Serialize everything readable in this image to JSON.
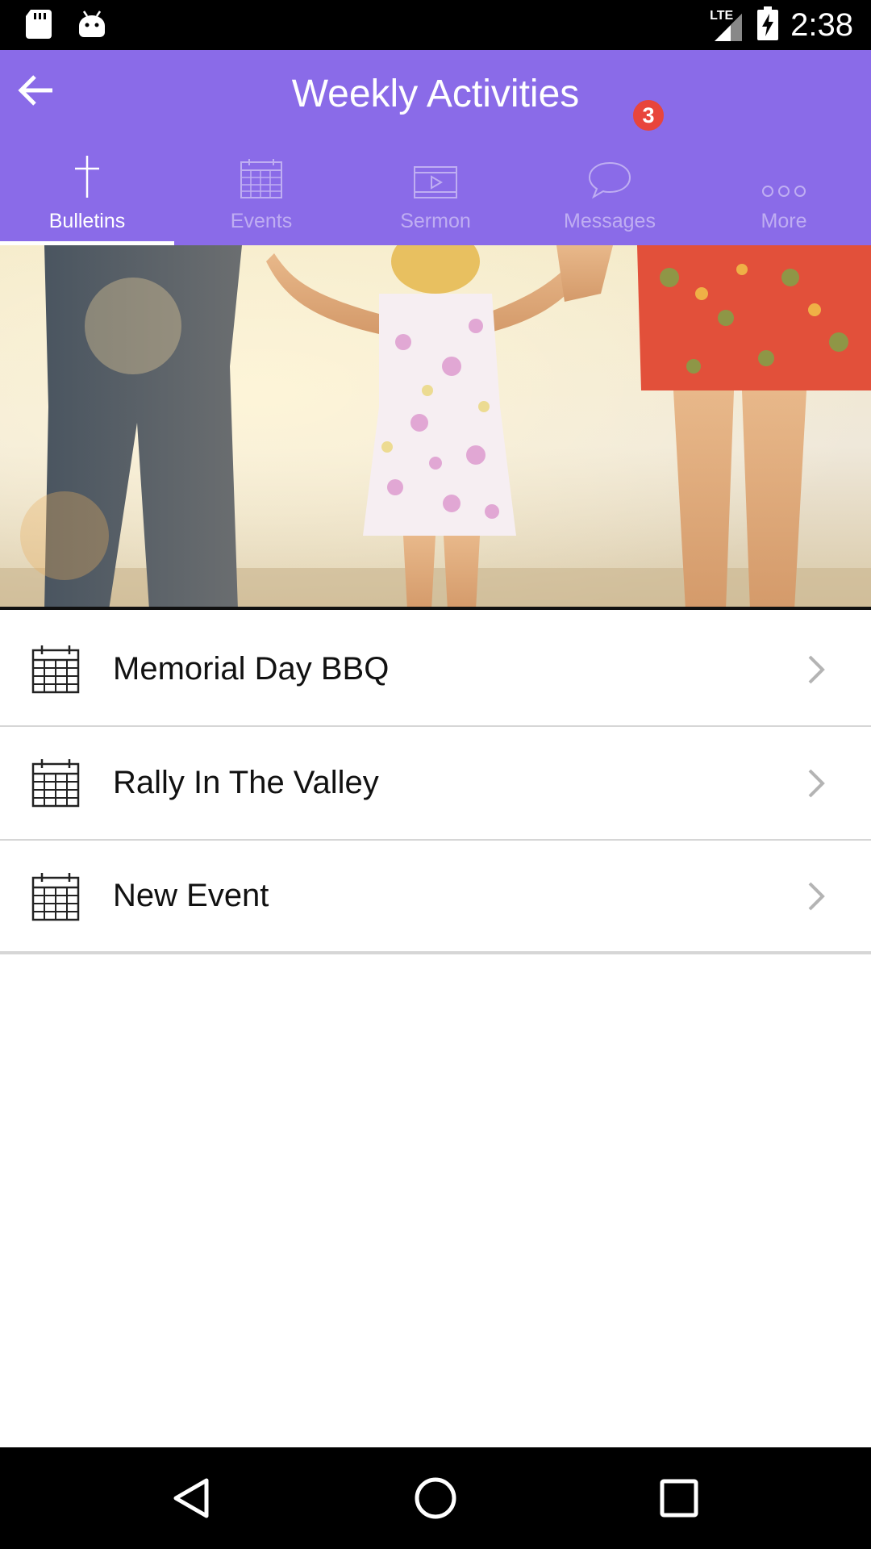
{
  "status_bar": {
    "time": "2:38",
    "network": "LTE",
    "icons": [
      "sd-card-icon",
      "android-icon",
      "signal-icon",
      "battery-charging-icon"
    ]
  },
  "header": {
    "title": "Weekly Activities",
    "back_icon": "arrow-left-icon"
  },
  "tabs": [
    {
      "label": "Bulletins",
      "icon": "cross-icon",
      "active": true
    },
    {
      "label": "Events",
      "icon": "calendar-icon",
      "active": false
    },
    {
      "label": "Sermon",
      "icon": "video-icon",
      "active": false
    },
    {
      "label": "Messages",
      "icon": "chat-bubble-icon",
      "active": false,
      "badge": "3"
    },
    {
      "label": "More",
      "icon": "more-dots-icon",
      "active": false
    }
  ],
  "hero": {
    "alt": "family holding hands at beach"
  },
  "list": {
    "items": [
      {
        "label": "Memorial Day BBQ",
        "icon": "calendar-icon"
      },
      {
        "label": "Rally In The Valley",
        "icon": "calendar-icon"
      },
      {
        "label": "New Event",
        "icon": "calendar-icon"
      }
    ]
  },
  "nav_bar": {
    "icons": [
      "back-triangle-icon",
      "home-circle-icon",
      "recents-square-icon"
    ]
  },
  "colors": {
    "accent": "#8a6be8",
    "badge": "#e8453c",
    "status_bar": "#000000"
  }
}
